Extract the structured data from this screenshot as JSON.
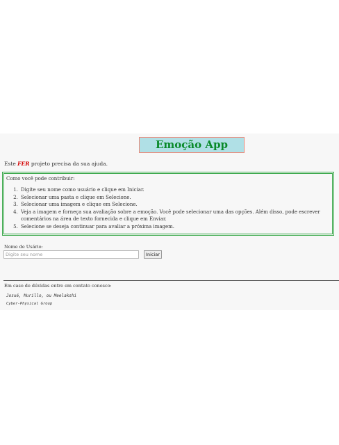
{
  "header": {
    "title": "Emoção App"
  },
  "intro": {
    "prefix": "Este ",
    "brand": "FER",
    "suffix": " projeto precisa da sua ajuda."
  },
  "contribution": {
    "heading": "Como você pode contribuir:",
    "steps": [
      "Digite seu nome como usuário e clique em Iniciar.",
      "Selecionar uma pasta e clique em Selecione.",
      "Selecionar uma imagem e clique em Selecione.",
      "Veja a imagem e forneça sua avaliação sobre a emoção. Você pode selecionar uma das opções. Além disso, pode escrever comentários na área de texto fornecida e clique em Enviar.",
      "Selecione se deseja continuar para avaliar a próxima imagem."
    ]
  },
  "form": {
    "user_label": "Nome de Usário:",
    "name_placeholder": "Digite seu nome",
    "name_value": "",
    "start_button": "Iniciar"
  },
  "footer": {
    "contact": "Em caso de dúvidas entre em contato conosco:",
    "authors": "Josué, Murillo, ou Meelakshi",
    "group": "Cyber-Physical Group"
  },
  "colors": {
    "title_bg": "#b0e0e6",
    "title_text": "#0a8a2a",
    "title_border": "#e98b7c",
    "brand_text": "#d40000",
    "box_border": "#3aa84a"
  }
}
